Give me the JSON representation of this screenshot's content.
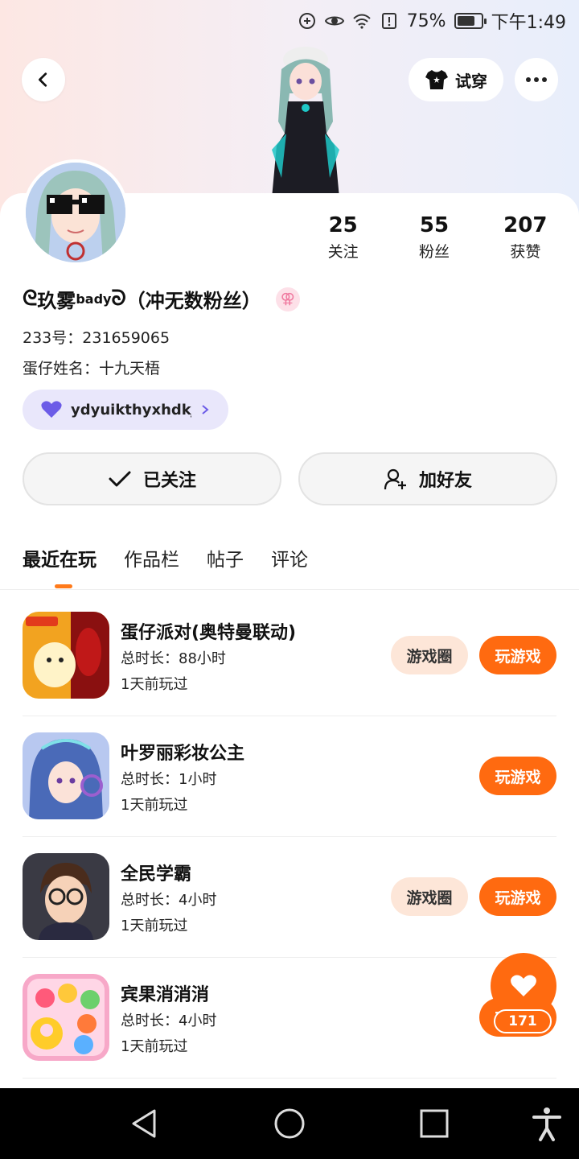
{
  "status_bar": {
    "battery": "75%",
    "battery_level": 0.75,
    "time": "下午1:49"
  },
  "header": {
    "tryon_label": "试穿"
  },
  "profile": {
    "stats": [
      {
        "num": "25",
        "label": "关注"
      },
      {
        "num": "55",
        "label": "粉丝"
      },
      {
        "num": "207",
        "label": "获赞"
      }
    ],
    "nickname_left_deco": "ᘓ",
    "nickname_main": "玖雾",
    "nickname_sup": "bady",
    "nickname_right_deco": "ᘐ",
    "nickname_tail": "（冲无数粉丝）",
    "gender_symbol": "⚢",
    "id_line": "233号：231659065",
    "eggname_line": "蛋仔姓名：十九天梧",
    "guild_text": "ydyuikthyxhdkjct"
  },
  "actions": {
    "follow_label": "已关注",
    "add_friend_label": "加好友"
  },
  "tabs": [
    {
      "label": "最近在玩",
      "active": true
    },
    {
      "label": "作品栏",
      "active": false
    },
    {
      "label": "帖子",
      "active": false
    },
    {
      "label": "评论",
      "active": false
    }
  ],
  "games": [
    {
      "title": "蛋仔派对(奥特曼联动)",
      "time": "总时长：88小时",
      "last": "1天前玩过",
      "circle_label": "游戏圈",
      "play_label": "玩游戏"
    },
    {
      "title": "叶罗丽彩妆公主",
      "time": "总时长：1小时",
      "last": "1天前玩过",
      "play_label": "玩游戏"
    },
    {
      "title": "全民学霸",
      "time": "总时长：4小时",
      "last": "1天前玩过",
      "circle_label": "游戏圈",
      "play_label": "玩游戏"
    },
    {
      "title": "宾果消消消",
      "time": "总时长：4小时",
      "last": "1天前玩过",
      "play_label": "玩游戏"
    }
  ],
  "like_fab": {
    "count": "171"
  },
  "colors": {
    "accent": "#ff6a10",
    "accent_light": "#fde6d8",
    "guild_bg": "#e9e7fb"
  }
}
